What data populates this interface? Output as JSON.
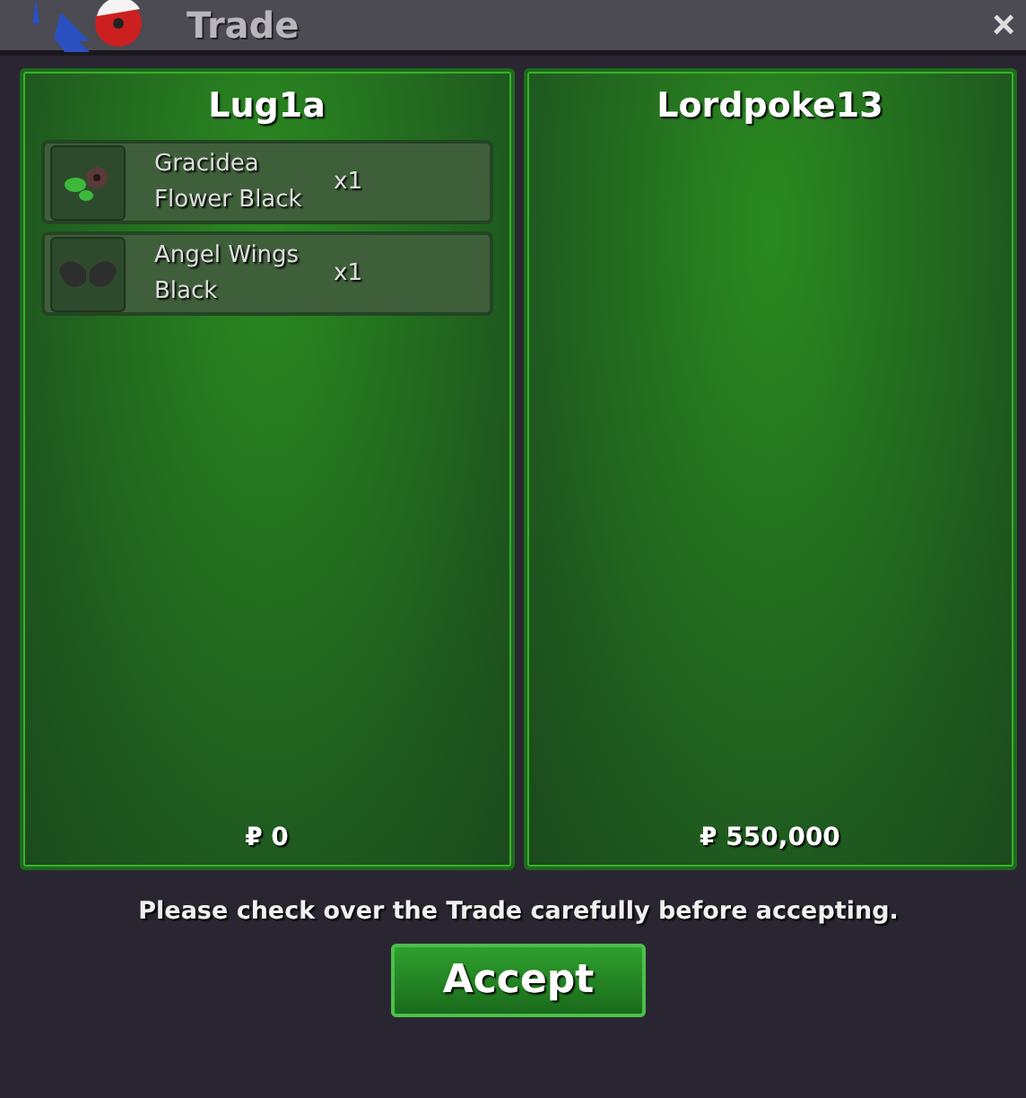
{
  "window": {
    "title": "Trade",
    "close": "×"
  },
  "panels": [
    {
      "name": "Lug1a",
      "items": [
        {
          "kind": "flower",
          "name": "Gracidea Flower Black",
          "qty": "x1"
        },
        {
          "kind": "wings",
          "name": "Angel Wings Black",
          "qty": "x1"
        }
      ],
      "money": "₽ 0"
    },
    {
      "name": "Lordpoke13",
      "money": "₽ 550,000"
    }
  ],
  "message": "Please check over the Trade carefully before accepting.",
  "button": "Accept"
}
